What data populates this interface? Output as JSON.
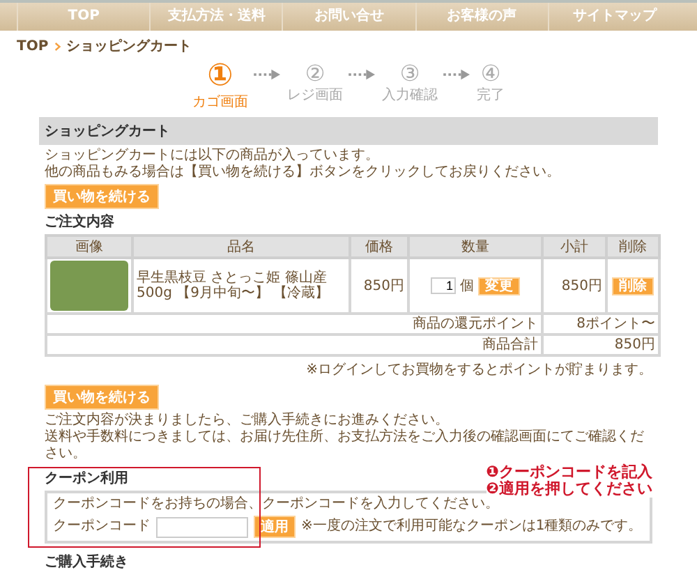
{
  "nav": [
    {
      "label": "TOP"
    },
    {
      "label": "支払方法・送料"
    },
    {
      "label": "お問い合せ"
    },
    {
      "label": "お客様の声"
    },
    {
      "label": "サイトマップ"
    }
  ],
  "breadcrumb": [
    "TOP",
    "ショッピングカート"
  ],
  "steps": [
    {
      "number": "①",
      "label": "カゴ画面",
      "selected": true
    },
    {
      "number": "②",
      "label": "レジ画面",
      "selected": false
    },
    {
      "number": "③",
      "label": "入力確認",
      "selected": false
    },
    {
      "number": "④",
      "label": "完了",
      "selected": false
    }
  ],
  "cart": {
    "title": "ショッピングカート",
    "intro": [
      "ショッピングカートには以下の商品が入っています。",
      "他の商品もみる場合は【買い物を続ける】ボタンをクリックしてお戻りください。"
    ],
    "continue_button": "買い物を続ける",
    "order_heading": "ご注文内容",
    "columns": [
      "画像",
      "品名",
      "価格",
      "数量",
      "小計",
      "削除"
    ],
    "rows": [
      {
        "name": "早生黒枝豆 さとっこ姫 篠山産500g 【9月中旬〜】 【冷蔵】",
        "price": "850円",
        "quantity": "1",
        "unit": "個",
        "change_button": "変更",
        "subtotal": "850円",
        "delete_button": "削除"
      }
    ],
    "points_label": "商品の還元ポイント",
    "points_value": "8ポイント〜",
    "total_label": "商品合計",
    "total_value": "850円"
  },
  "login_note": "※ログインしてお買物をするとポイントが貯まります。",
  "continue_button": "買い物を続ける",
  "notices": [
    "ご注文内容が決まりましたら、ご購入手続きにお進みください。",
    "送料や手数料につきましては、お届け先住所、お支払方法をご入力後の確認画面にてご確認ください。"
  ],
  "coupon": {
    "title": "クーポン利用",
    "description": "クーポンコードをお持ちの場合、クーポンコードを入力してください。",
    "field_label": "クーポンコード",
    "apply_button": "適用",
    "note": "※一度の注文で利用可能なクーポンは1種類のみです。"
  },
  "annotation": [
    "❶クーポンコードを記入",
    "❷適用を押してください"
  ],
  "next_heading": "ご購入手続き"
}
